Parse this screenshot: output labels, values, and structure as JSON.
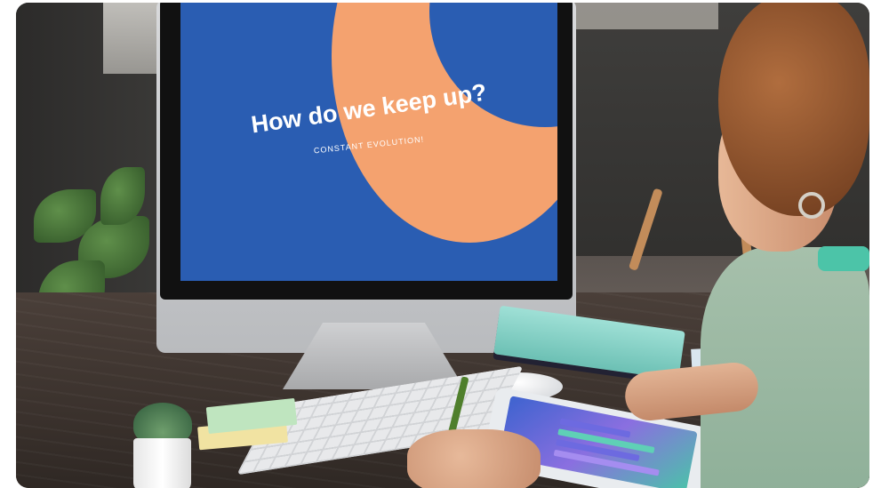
{
  "slide": {
    "title": "How do we keep up?",
    "subtitle": "CONSTANT EVOLUTION!"
  },
  "colors": {
    "slide_blue": "#2a5db2",
    "slide_orange": "#f4a26f",
    "notebook_teal": "#6cc0b4",
    "hoodie_green": "#8fb099"
  }
}
